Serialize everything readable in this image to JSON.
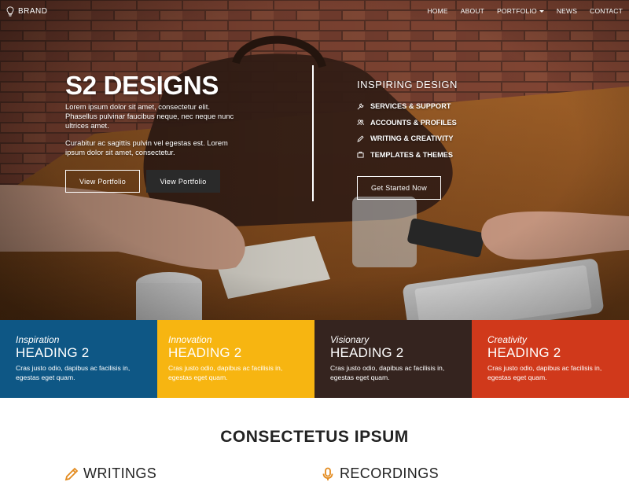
{
  "navbar": {
    "brand": "BRAND",
    "items": [
      {
        "label": "HOME"
      },
      {
        "label": "ABOUT"
      },
      {
        "label": "PORTFOLIO"
      },
      {
        "label": "NEWS"
      },
      {
        "label": "CONTACT"
      }
    ]
  },
  "hero": {
    "title": "S2 DESIGNS",
    "paragraph1": "Lorem ipsum dolor sit amet, consectetur elit. Phasellus pulvinar faucibus neque, nec neque nunc ultrices amet.",
    "paragraph2": "Curabitur ac sagittis pulvin vel egestas est. Lorem ipsum dolor sit amet, consectetur.",
    "button1": "View Portfolio",
    "button2": "View Portfolio",
    "right_title": "INSPIRING DESIGN",
    "services": [
      {
        "label": "SERVICES & SUPPORT",
        "icon": "wrench-icon"
      },
      {
        "label": "ACCOUNTS & PROFILES",
        "icon": "users-icon"
      },
      {
        "label": "WRITING & CREATIVITY",
        "icon": "pencil-icon"
      },
      {
        "label": "TEMPLATES & THEMES",
        "icon": "briefcase-icon"
      }
    ],
    "cta": "Get Started Now"
  },
  "features": [
    {
      "kicker": "Inspiration",
      "heading": "HEADING 2",
      "text": "Cras justo odio, dapibus ac facilisis in, egestas eget quam.",
      "color": "#0e5785"
    },
    {
      "kicker": "Innovation",
      "heading": "HEADING 2",
      "text": "Cras justo odio, dapibus ac facilisis in, egestas eget quam.",
      "color": "#f7b511"
    },
    {
      "kicker": "Visionary",
      "heading": "HEADING 2",
      "text": "Cras justo odio, dapibus ac facilisis in, egestas eget quam.",
      "color": "#35241f"
    },
    {
      "kicker": "Creativity",
      "heading": "HEADING 2",
      "text": "Cras justo odio, dapibus ac facilisis in, egestas eget quam.",
      "color": "#d0391b"
    }
  ],
  "bottom": {
    "section_title": "CONSECTETUS IPSUM",
    "col1": {
      "label": "WRITINGS",
      "icon": "pen-icon"
    },
    "col2": {
      "label": "RECORDINGS",
      "icon": "microphone-icon"
    },
    "accent": "#e38b1f"
  }
}
